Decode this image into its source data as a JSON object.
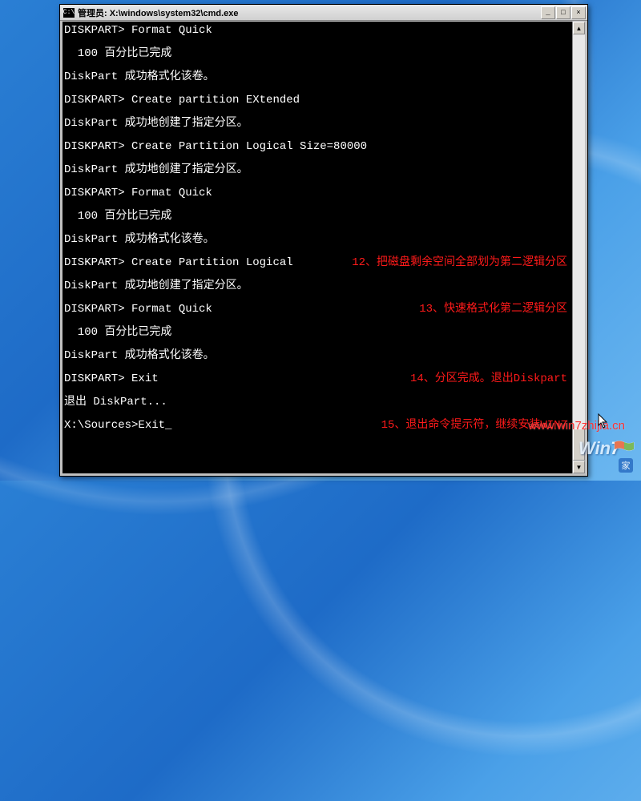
{
  "titlebar": {
    "icon_label": "C:\\",
    "title": "管理员: X:\\windows\\system32\\cmd.exe"
  },
  "win_controls": {
    "minimize": "_",
    "maximize": "□",
    "close": "×"
  },
  "terminal": {
    "lines": [
      {
        "text": "DISKPART> Format Quick",
        "anno": ""
      },
      {
        "spacer": true
      },
      {
        "text": "  100 百分比已完成",
        "anno": ""
      },
      {
        "spacer": true
      },
      {
        "text": "DiskPart 成功格式化该卷。",
        "anno": ""
      },
      {
        "spacer": true
      },
      {
        "text": "DISKPART> Create partition EXtended",
        "anno": ""
      },
      {
        "spacer": true
      },
      {
        "text": "DiskPart 成功地创建了指定分区。",
        "anno": ""
      },
      {
        "spacer": true
      },
      {
        "text": "DISKPART> Create Partition Logical Size=80000",
        "anno": ""
      },
      {
        "spacer": true
      },
      {
        "text": "DiskPart 成功地创建了指定分区。",
        "anno": ""
      },
      {
        "spacer": true
      },
      {
        "text": "DISKPART> Format Quick",
        "anno": ""
      },
      {
        "spacer": true
      },
      {
        "text": "  100 百分比已完成",
        "anno": ""
      },
      {
        "spacer": true
      },
      {
        "text": "DiskPart 成功格式化该卷。",
        "anno": ""
      },
      {
        "spacer": true
      },
      {
        "text": "DISKPART> Create Partition Logical",
        "anno": "12、把磁盘剩余空间全部划为第二逻辑分区"
      },
      {
        "spacer": true
      },
      {
        "text": "DiskPart 成功地创建了指定分区。",
        "anno": ""
      },
      {
        "spacer": true
      },
      {
        "text": "DISKPART> Format Quick",
        "anno": "13、快速格式化第二逻辑分区"
      },
      {
        "spacer": true
      },
      {
        "text": "  100 百分比已完成",
        "anno": ""
      },
      {
        "spacer": true
      },
      {
        "text": "DiskPart 成功格式化该卷。",
        "anno": ""
      },
      {
        "spacer": true
      },
      {
        "text": "DISKPART> Exit",
        "anno": "14、分区完成。退出Diskpart"
      },
      {
        "spacer": true
      },
      {
        "text": "退出 DiskPart...",
        "anno": ""
      },
      {
        "spacer": true
      },
      {
        "text": "X:\\Sources>Exit_",
        "anno": "15、退出命令提示符，继续安装WIN7"
      }
    ]
  },
  "watermark": "www.win7zhijia.cn",
  "logo": {
    "text": "Win",
    "seven": "7",
    "home": "家"
  },
  "scrollbar": {
    "up": "▲",
    "down": "▼"
  }
}
